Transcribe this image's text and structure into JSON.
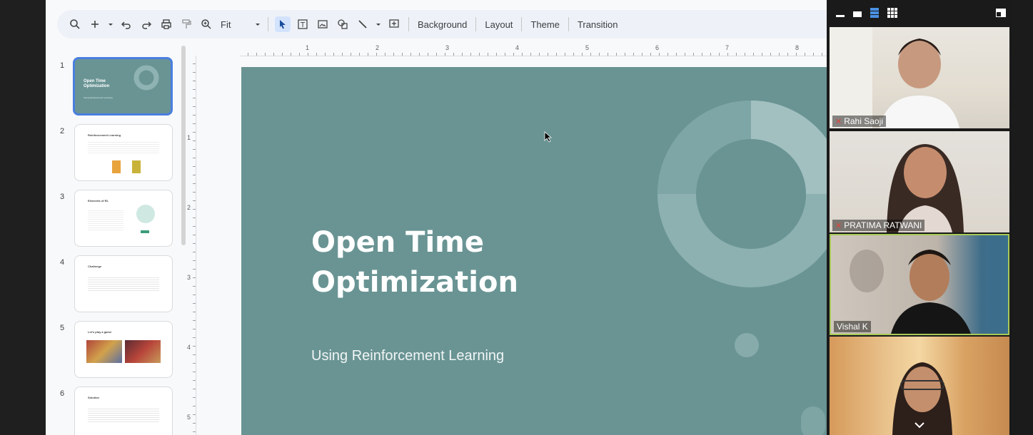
{
  "toolbar": {
    "zoom_label": "Fit",
    "background_label": "Background",
    "layout_label": "Layout",
    "theme_label": "Theme",
    "transition_label": "Transition"
  },
  "slides": [
    {
      "number": "1",
      "title": "Open Time Optimization",
      "subtitle": "Using Reinforcement Learning"
    },
    {
      "number": "2",
      "title": "Reinforcement Learning"
    },
    {
      "number": "3",
      "title": "Elements of RL"
    },
    {
      "number": "4",
      "title": "Challenge"
    },
    {
      "number": "5",
      "title": "Let's play a game"
    },
    {
      "number": "6",
      "title": "Solution"
    }
  ],
  "ruler": {
    "top": [
      "1",
      "2",
      "3",
      "4",
      "5",
      "6",
      "7",
      "8"
    ],
    "left": [
      "1",
      "2",
      "3",
      "4",
      "5"
    ]
  },
  "main_slide": {
    "title": "Open Time Optimization",
    "subtitle": "Using Reinforcement Learning"
  },
  "participants": [
    {
      "name": "Rahi Saoji",
      "muted": true
    },
    {
      "name": "PRATIMA RATWANI",
      "muted": true
    },
    {
      "name": "Vishal K",
      "muted": false,
      "active_speaker": true
    },
    {
      "name": "",
      "muted": false
    }
  ],
  "colors": {
    "slide_bg": "#6a9494",
    "accent_active": "#4a7fe0",
    "speaker_border": "#a7c957"
  }
}
